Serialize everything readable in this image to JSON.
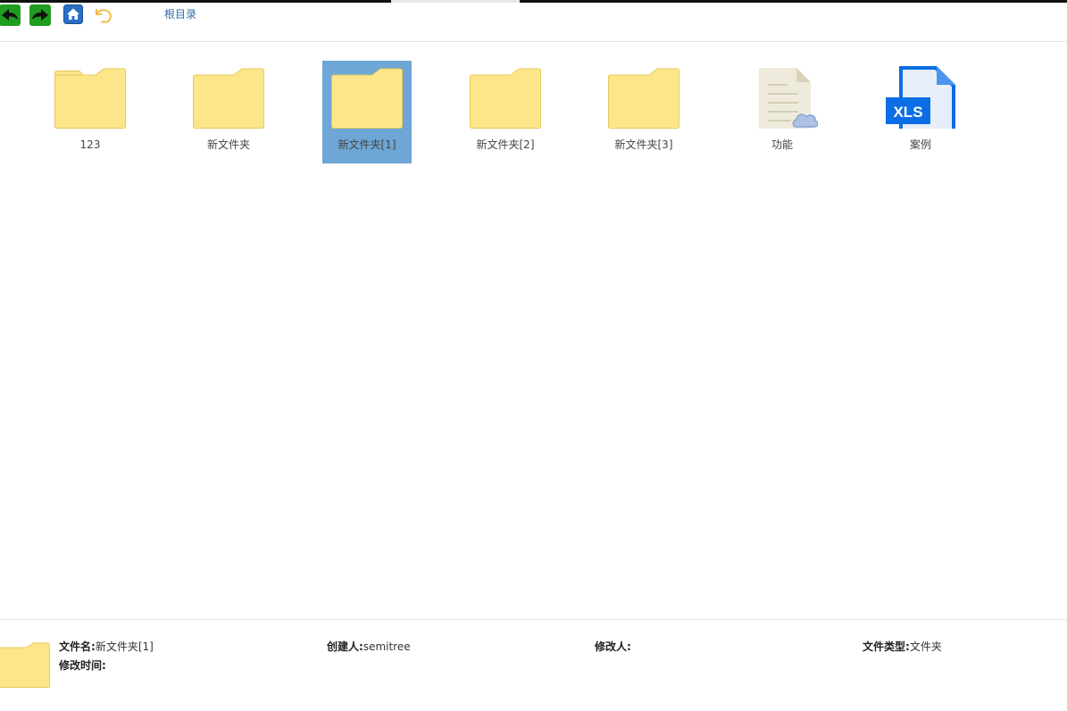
{
  "toolbar": {
    "back_icon": "back-arrow-icon",
    "forward_icon": "forward-arrow-icon",
    "home_icon": "home-icon",
    "undo_icon": "undo-icon",
    "breadcrumb": "根目录",
    "accent": "#1f9d1f"
  },
  "items": [
    {
      "label": "123",
      "type": "folder",
      "selected": false
    },
    {
      "label": "新文件夹",
      "type": "folder",
      "selected": false
    },
    {
      "label": "新文件夹[1]",
      "type": "folder",
      "selected": true
    },
    {
      "label": "新文件夹[2]",
      "type": "folder",
      "selected": false
    },
    {
      "label": "新文件夹[3]",
      "type": "folder",
      "selected": false
    },
    {
      "label": "功能",
      "type": "cloud-document",
      "selected": false
    },
    {
      "label": "案例",
      "type": "xls",
      "selected": false
    }
  ],
  "details": {
    "filename_label": "文件名:",
    "filename_value": "新文件夹[1]",
    "creator_label": "创建人:",
    "creator_value": "semitree",
    "modifier_label": "修改人:",
    "modifier_value": "",
    "filetype_label": "文件类型:",
    "filetype_value": "文件夹",
    "modtime_label": "修改时间:",
    "modtime_value": ""
  },
  "colors": {
    "folder_fill": "#fde68a",
    "folder_stroke": "#e6c95a",
    "selection": "#6ea6d6",
    "xls_blue": "#1a73e8"
  }
}
